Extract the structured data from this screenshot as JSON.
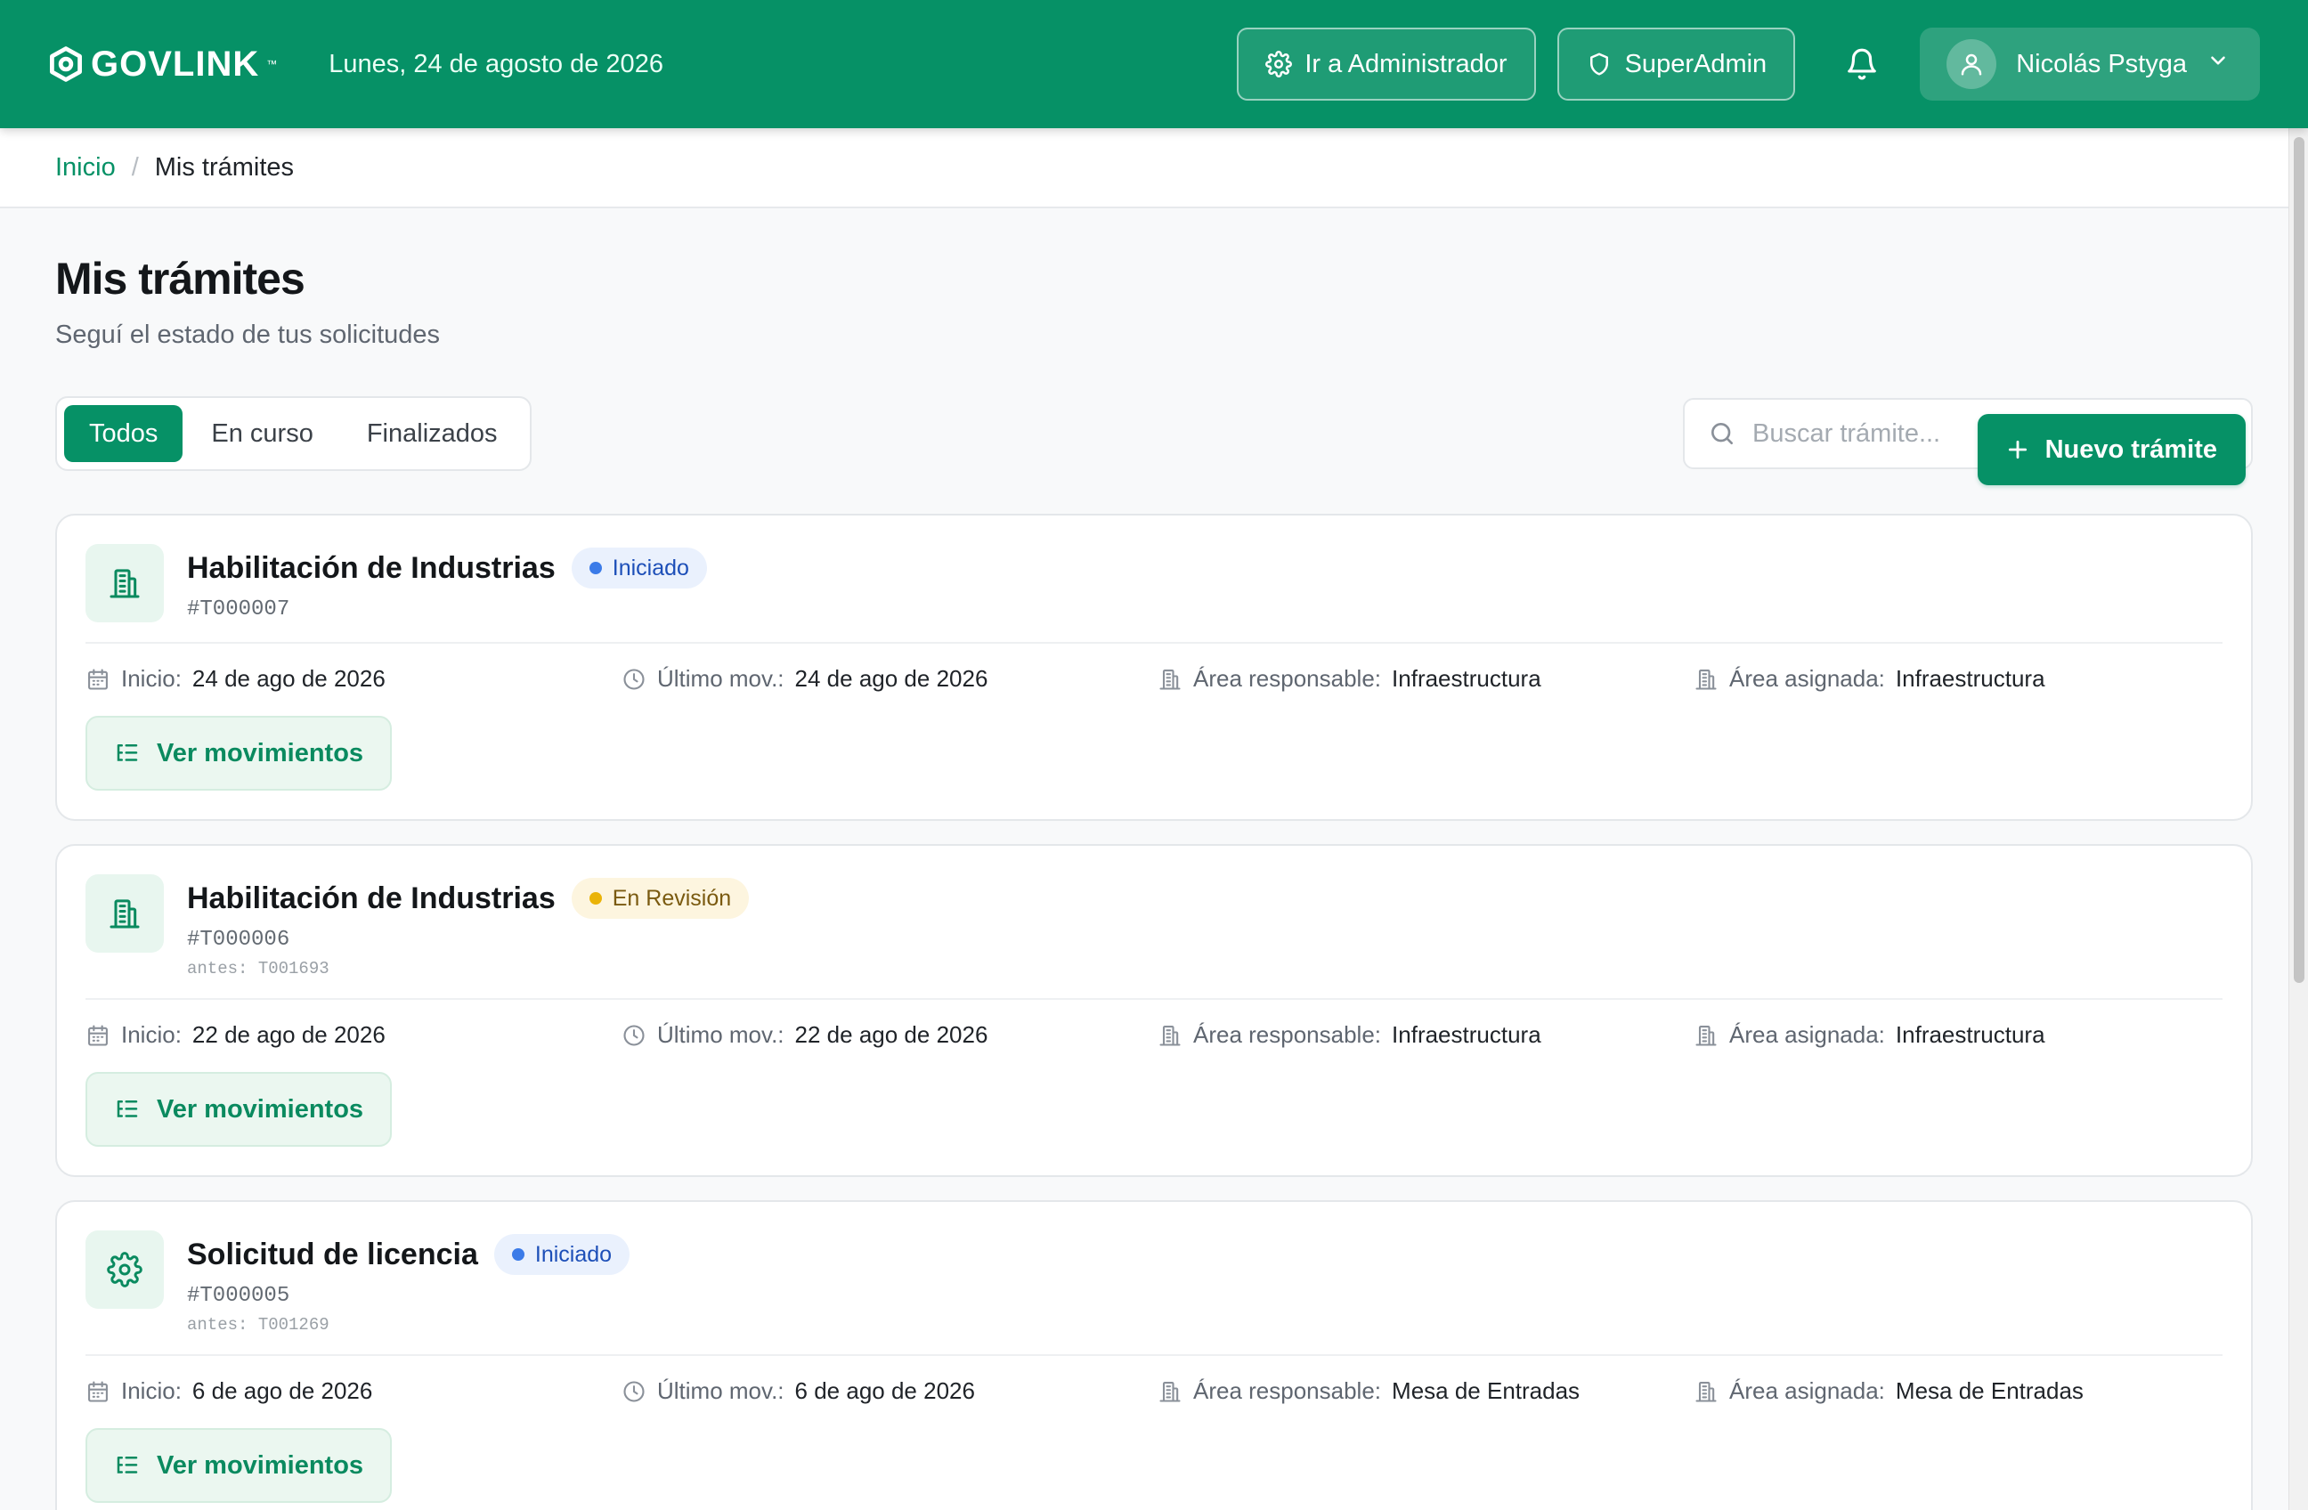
{
  "header": {
    "brand": "GOVLINK",
    "brand_tm": "™",
    "date": "Lunes, 24 de agosto de 2026",
    "admin_button": "Ir a Administrador",
    "superadmin_button": "SuperAdmin",
    "user_name": "Nicolás Pstyga"
  },
  "breadcrumb": {
    "home": "Inicio",
    "separator": "/",
    "current": "Mis trámites"
  },
  "page": {
    "title": "Mis trámites",
    "subtitle": "Seguí el estado de tus solicitudes",
    "new_button": "Nuevo trámite"
  },
  "tabs": [
    "Todos",
    "En curso",
    "Finalizados"
  ],
  "active_tab": "Todos",
  "search": {
    "placeholder": "Buscar trámite..."
  },
  "labels": {
    "inicio": "Inicio:",
    "ultimo": "Último mov.:",
    "area_responsable": "Área responsable:",
    "area_asignada": "Área asignada:",
    "ver_movimientos": "Ver movimientos"
  },
  "tramites": [
    {
      "title": "Habilitación de Industrias",
      "icon": "building-icon",
      "status": "Iniciado",
      "status_color": "blue",
      "code": "#T000007",
      "previous": "",
      "inicio": "24 de ago de 2026",
      "ultimo": "24 de ago de 2026",
      "area_responsable": "Infraestructura",
      "area_asignada": "Infraestructura"
    },
    {
      "title": "Habilitación de Industrias",
      "icon": "building-icon",
      "status": "En Revisión",
      "status_color": "yellow",
      "code": "#T000006",
      "previous": "antes: T001693",
      "inicio": "22 de ago de 2026",
      "ultimo": "22 de ago de 2026",
      "area_responsable": "Infraestructura",
      "area_asignada": "Infraestructura"
    },
    {
      "title": "Solicitud de licencia",
      "icon": "gear-icon",
      "status": "Iniciado",
      "status_color": "blue",
      "code": "#T000005",
      "previous": "antes: T001269",
      "inicio": "6 de ago de 2026",
      "ultimo": "6 de ago de 2026",
      "area_responsable": "Mesa de Entradas",
      "area_asignada": "Mesa de Entradas"
    }
  ],
  "colors": {
    "brand_green": "#069166",
    "badge_blue": "#3b7be8",
    "badge_yellow": "#eab308"
  }
}
